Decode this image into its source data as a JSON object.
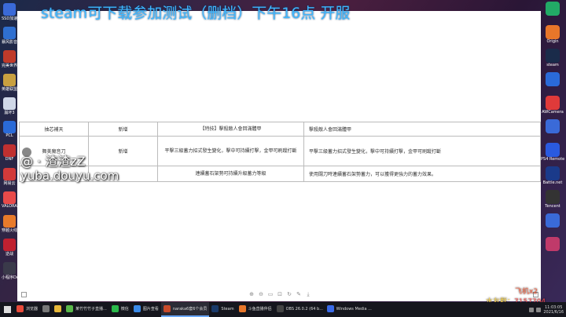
{
  "banner": {
    "text": "steam可下载参加测试（删档）下午16点 开服"
  },
  "desktop_left": [
    {
      "label": "SSD加速",
      "color": "#3a6ad8"
    },
    {
      "label": "暴风影音",
      "color": "#2f6fd0"
    },
    {
      "label": "完美世界",
      "color": "#c03a2a"
    },
    {
      "label": "英雄联盟",
      "color": "#c8a040"
    },
    {
      "label": "崩坏3",
      "color": "#d0d8e8"
    },
    {
      "label": "PCL",
      "color": "#2a6ad8"
    },
    {
      "label": "DNF",
      "color": "#c03030"
    },
    {
      "label": "网易云",
      "color": "#d23a3a"
    },
    {
      "label": "VALORANT",
      "color": "#e84a4a"
    },
    {
      "label": "穿越火线",
      "color": "#e87a2a"
    },
    {
      "label": "逆战",
      "color": "#c02030"
    },
    {
      "label": "小程序Demo",
      "color": "#3a3a4a"
    }
  ],
  "desktop_right": [
    {
      "label": "",
      "color": "#22aa66"
    },
    {
      "label": "Origin",
      "color": "#e8762a"
    },
    {
      "label": "steam",
      "color": "#1a2b4a"
    },
    {
      "label": "",
      "color": "#2a6ad8"
    },
    {
      "label": "AWCamera",
      "color": "#e03a3a"
    },
    {
      "label": "",
      "color": "#3a6ad8"
    },
    {
      "label": "PS4 Remote",
      "color": "#2a5ae0"
    },
    {
      "label": "Battle.net",
      "color": "#1a3a8a"
    },
    {
      "label": "Tencent",
      "color": "#333"
    },
    {
      "label": "",
      "color": "#3a6ad8"
    },
    {
      "label": "",
      "color": "#c03a6a"
    }
  ],
  "table": {
    "rows": [
      [
        "抽芯補天",
        "新增",
        "【特技】擊殺敵人會回滿體甲",
        "擊殺敵人會回滿體甲"
      ],
      [
        "舞美魔音刀",
        "新增",
        "平擊三級蓄力招式發生變化，擊中可持續打擊，金甲可刷蹤打斷",
        "平擊三級蓄力招式發生變化，擊中可持續打擊，金甲可刷蹤打斷"
      ],
      [
        "",
        "",
        "連續蓄石架勢可持續升級蓄力等級",
        "使用闊刀時連續蓄石架勢蓄力，可以獲得更強力的蓄力效果。"
      ]
    ]
  },
  "watermark": {
    "line1": "@ · 渣渣zZ",
    "line2": "yuba.douyu.com"
  },
  "gifts": {
    "line1": "飞机x2",
    "line2_prefix": "水友群：",
    "line2_value": "7157704"
  },
  "taskbar": {
    "items": [
      {
        "label": "浏览器",
        "color": "#e84a3a",
        "active": false
      },
      {
        "label": "",
        "color": "#777",
        "active": false
      },
      {
        "label": "",
        "color": "#e8b83a",
        "active": false
      },
      {
        "label": "某竹竹竹子直播...",
        "color": "#5ab84a",
        "active": false
      },
      {
        "label": "微信",
        "color": "#2ab84a",
        "active": false
      },
      {
        "label": "图片查看",
        "color": "#3a8ae8",
        "active": false
      },
      {
        "label": "naraka6套6个会员",
        "color": "#c84a2a",
        "active": true
      },
      {
        "label": "Steam",
        "color": "#1a3a6a",
        "active": false
      },
      {
        "label": "斗鱼直播伴侣",
        "color": "#e8762a",
        "active": false
      },
      {
        "label": "OBS 26.0.2 (64 b...",
        "color": "#444",
        "active": false
      },
      {
        "label": "Windows Media ...",
        "color": "#3a6ae8",
        "active": false
      }
    ],
    "clock_time": "11:03:05",
    "clock_date": "2021/6/16"
  }
}
